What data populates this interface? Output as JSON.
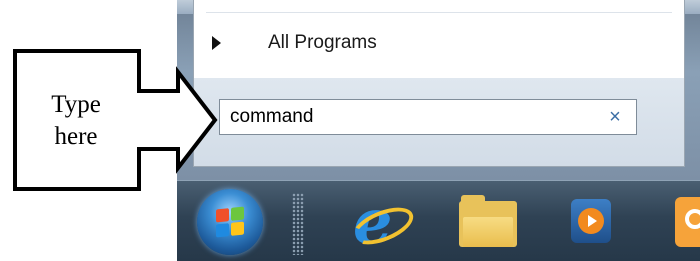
{
  "start_menu": {
    "all_programs_label": "All Programs",
    "search": {
      "value": "command",
      "clear_glyph": "×"
    }
  },
  "callout": {
    "line1": "Type",
    "line2": "here"
  },
  "taskbar": {
    "apps": [
      {
        "name": "start-orb",
        "icon": "windows-flag-icon"
      },
      {
        "name": "internet-explorer",
        "icon": "internet-explorer-icon"
      },
      {
        "name": "windows-explorer",
        "icon": "folder-icon"
      },
      {
        "name": "media-player",
        "icon": "media-player-icon"
      },
      {
        "name": "pinned-app",
        "icon": "app-icon"
      }
    ]
  },
  "colors": {
    "taskbar": "#2f4254",
    "search_accent": "#3b6ea5",
    "start_menu_frame": "#7d90a6"
  }
}
